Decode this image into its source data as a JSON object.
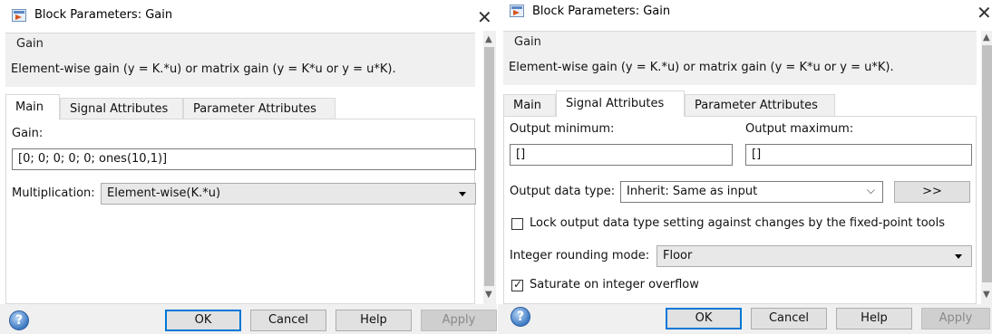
{
  "dialog_left": {
    "title": "Block Parameters: Gain",
    "close_glyph": "✕",
    "group_label": "Gain",
    "description": "Element-wise gain (y = K.*u) or matrix gain (y = K*u or y = u*K).",
    "tabs": [
      "Main",
      "Signal Attributes",
      "Parameter Attributes"
    ],
    "active_tab": "Main",
    "gain_label": "Gain:",
    "gain_value": "[0; 0; 0; 0; 0; ones(10,1)]",
    "multiplication_label": "Multiplication:",
    "multiplication_value": "Element-wise(K.*u)",
    "buttons": {
      "ok": "OK",
      "cancel": "Cancel",
      "help": "Help",
      "apply": "Apply"
    }
  },
  "dialog_right": {
    "title": "Block Parameters: Gain",
    "close_glyph": "✕",
    "group_label": "Gain",
    "description": "Element-wise gain (y = K.*u) or matrix gain (y = K*u or y = u*K).",
    "tabs": [
      "Main",
      "Signal Attributes",
      "Parameter Attributes"
    ],
    "active_tab": "Signal Attributes",
    "output_minimum_label": "Output minimum:",
    "output_minimum_value": "[]",
    "output_maximum_label": "Output maximum:",
    "output_maximum_value": "[]",
    "output_data_type_label": "Output data type:",
    "output_data_type_value": "Inherit: Same as input",
    "assistant_button": ">>",
    "lock_label": "Lock output data type setting against changes by the fixed-point tools",
    "lock_checked": false,
    "rounding_label": "Integer rounding mode:",
    "rounding_value": "Floor",
    "saturate_label": "Saturate on integer overflow",
    "saturate_checked": true,
    "buttons": {
      "ok": "OK",
      "cancel": "Cancel",
      "help": "Help",
      "apply": "Apply"
    }
  },
  "icons": {
    "dialog": "simulink-block-icon",
    "help": "help-question-icon",
    "dropdown": "chevron-down-icon",
    "checkmark": "✓"
  },
  "colors": {
    "default_button_border": "#0078d7",
    "panel_background": "#f0f0f0",
    "disabled_text": "#8a8a8a"
  }
}
